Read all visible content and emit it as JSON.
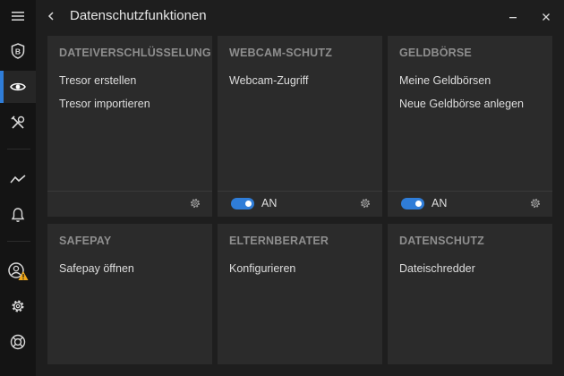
{
  "window": {
    "title": "Datenschutzfunktionen",
    "back_icon": "chevron-left-icon",
    "minimize_icon": "minimize-icon",
    "close_icon": "close-icon"
  },
  "sidebar": {
    "items": [
      {
        "name": "menu",
        "icon": "hamburger-icon"
      },
      {
        "name": "protection",
        "icon": "shield-b-icon"
      },
      {
        "name": "privacy",
        "icon": "eye-icon",
        "active": true
      },
      {
        "name": "utilities",
        "icon": "tools-icon"
      },
      {
        "name": "reports",
        "icon": "activity-icon"
      },
      {
        "name": "notifications",
        "icon": "bell-icon"
      },
      {
        "name": "account",
        "icon": "user-warning-icon"
      },
      {
        "name": "settings",
        "icon": "gear-icon"
      },
      {
        "name": "support",
        "icon": "lifebuoy-icon"
      }
    ],
    "accent_color": "#2f7dd8",
    "warning_color": "#f0a818"
  },
  "cards": [
    {
      "title": "DATEIVERSCHLÜSSELUNG",
      "links": [
        "Tresor erstellen",
        "Tresor importieren"
      ],
      "settings_icon": "gear-icon"
    },
    {
      "title": "WEBCAM-SCHUTZ",
      "links": [
        "Webcam-Zugriff"
      ],
      "toggle": {
        "on": true,
        "label": "AN"
      },
      "settings_icon": "gear-icon"
    },
    {
      "title": "GELDBÖRSE",
      "links": [
        "Meine Geldbörsen",
        "Neue Geldbörse anlegen"
      ],
      "toggle": {
        "on": true,
        "label": "AN"
      },
      "settings_icon": "gear-icon"
    },
    {
      "title": "SAFEPAY",
      "links": [
        "Safepay öffnen"
      ]
    },
    {
      "title": "ELTERNBERATER",
      "links": [
        "Konfigurieren"
      ]
    },
    {
      "title": "DATENSCHUTZ",
      "links": [
        "Dateischredder"
      ]
    }
  ]
}
